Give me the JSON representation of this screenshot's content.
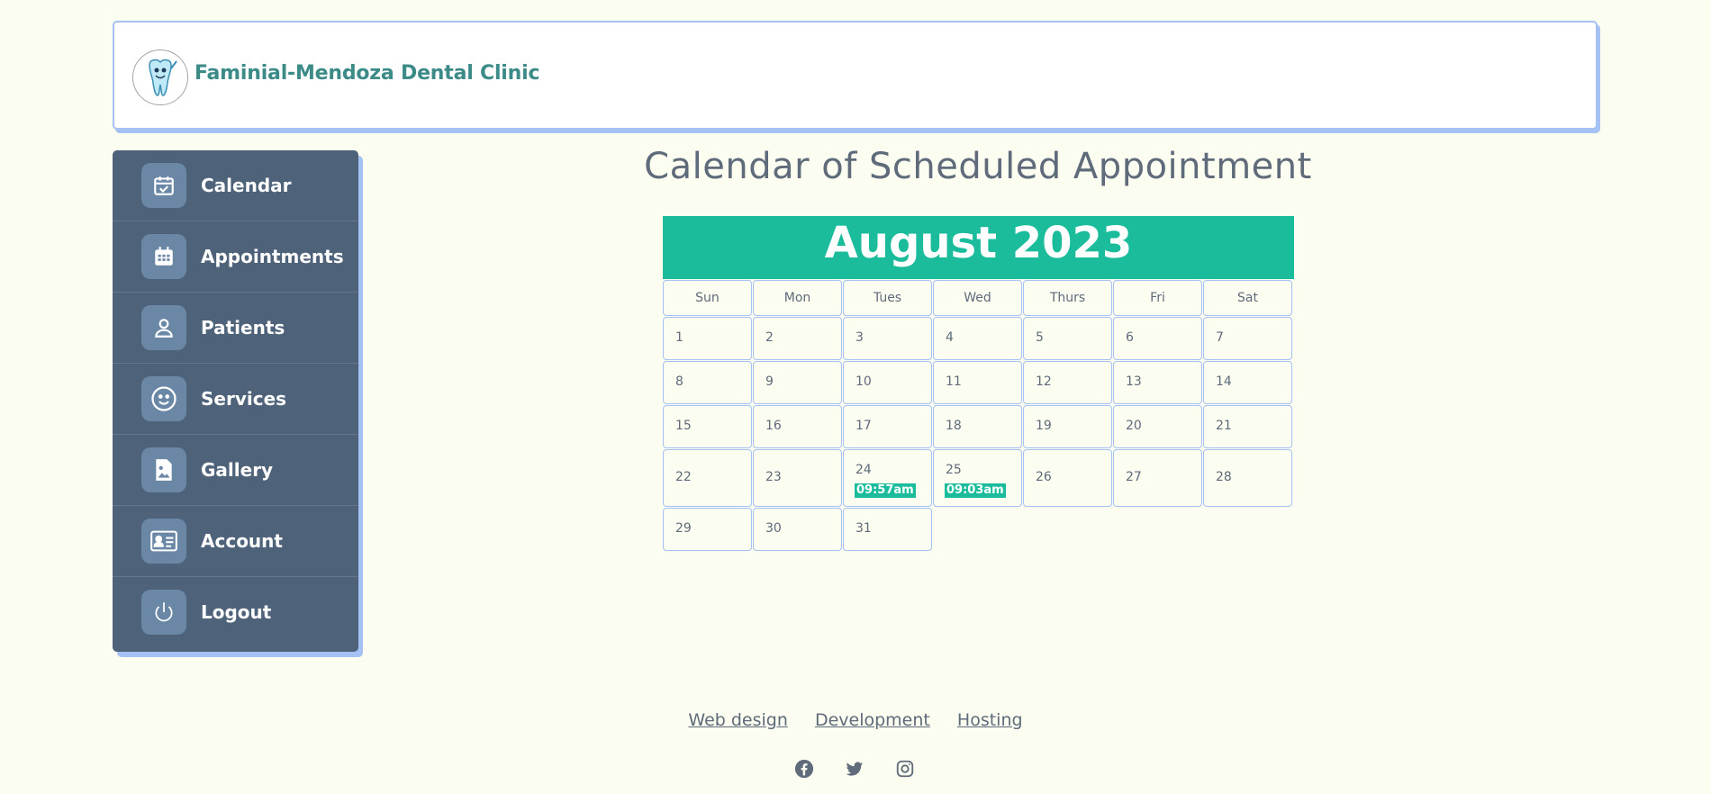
{
  "brand": {
    "name": "Faminial-Mendoza Dental Clinic"
  },
  "sidebar": {
    "items": [
      {
        "label": "Calendar",
        "icon": "calendar-check-icon"
      },
      {
        "label": "Appointments",
        "icon": "calendar-grid-icon"
      },
      {
        "label": "Patients",
        "icon": "user-icon"
      },
      {
        "label": "Services",
        "icon": "smile-icon"
      },
      {
        "label": "Gallery",
        "icon": "image-file-icon"
      },
      {
        "label": "Account",
        "icon": "id-card-icon"
      },
      {
        "label": "Logout",
        "icon": "power-icon"
      }
    ]
  },
  "main": {
    "title": "Calendar of Scheduled Appointment",
    "calendar": {
      "month_label": "August 2023",
      "weekdays": [
        "Sun",
        "Mon",
        "Tues",
        "Wed",
        "Thurs",
        "Fri",
        "Sat"
      ],
      "days": [
        "1",
        "2",
        "3",
        "4",
        "5",
        "6",
        "7",
        "8",
        "9",
        "10",
        "11",
        "12",
        "13",
        "14",
        "15",
        "16",
        "17",
        "18",
        "19",
        "20",
        "21",
        "22",
        "23",
        "24",
        "25",
        "26",
        "27",
        "28",
        "29",
        "30",
        "31"
      ],
      "appointments": {
        "24": "09:57am",
        "25": "09:03am"
      }
    }
  },
  "footer": {
    "links": [
      "Web design",
      "Development",
      "Hosting"
    ],
    "social": [
      "facebook-icon",
      "twitter-icon",
      "instagram-icon"
    ]
  },
  "colors": {
    "accent": "#1abc9c",
    "sidebar": "#4e627a",
    "border": "#a6c1f3",
    "brand_text": "#3c8b88"
  }
}
